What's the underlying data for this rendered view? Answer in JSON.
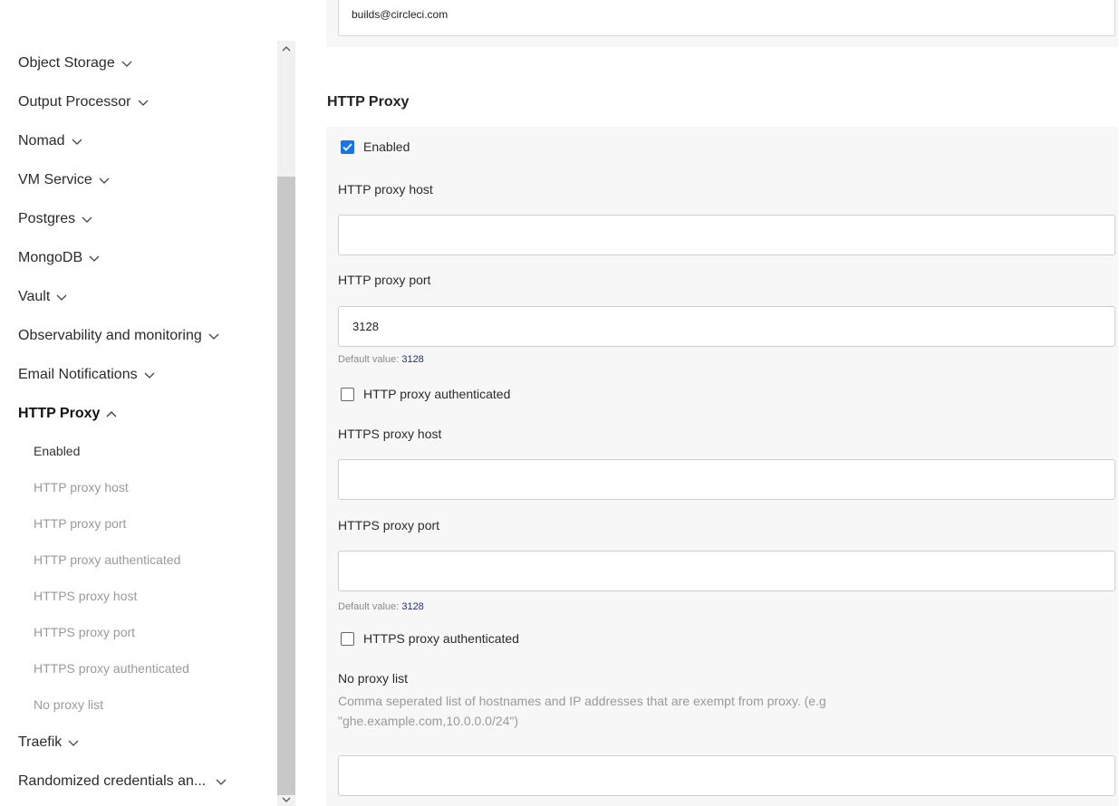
{
  "sidebar": {
    "items": [
      {
        "label": "Object Storage"
      },
      {
        "label": "Output Processor"
      },
      {
        "label": "Nomad"
      },
      {
        "label": "VM Service"
      },
      {
        "label": "Postgres"
      },
      {
        "label": "MongoDB"
      },
      {
        "label": "Vault"
      },
      {
        "label": "Observability and monitoring"
      },
      {
        "label": "Email Notifications"
      }
    ],
    "active_section": {
      "label": "HTTP Proxy",
      "sub_items": [
        {
          "label": "Enabled"
        },
        {
          "label": "HTTP proxy host"
        },
        {
          "label": "HTTP proxy port"
        },
        {
          "label": "HTTP proxy authenticated"
        },
        {
          "label": "HTTPS proxy host"
        },
        {
          "label": "HTTPS proxy port"
        },
        {
          "label": "HTTPS proxy authenticated"
        },
        {
          "label": "No proxy list"
        }
      ]
    },
    "after_items": [
      {
        "label": "Traefik"
      },
      {
        "label": "Randomized credentials an..."
      }
    ]
  },
  "main": {
    "top_field_value": "builds@circleci.com",
    "section_title": "HTTP Proxy",
    "enabled": {
      "label": "Enabled",
      "checked": true
    },
    "http_proxy_host": {
      "label": "HTTP proxy host",
      "value": ""
    },
    "http_proxy_port": {
      "label": "HTTP proxy port",
      "value": "3128",
      "default_prefix": "Default value:",
      "default_value": "3128"
    },
    "http_proxy_authenticated": {
      "label": "HTTP proxy authenticated",
      "checked": false
    },
    "https_proxy_host": {
      "label": "HTTPS proxy host",
      "value": ""
    },
    "https_proxy_port": {
      "label": "HTTPS proxy port",
      "value": "",
      "default_prefix": "Default value:",
      "default_value": "3128"
    },
    "https_proxy_authenticated": {
      "label": "HTTPS proxy authenticated",
      "checked": false
    },
    "no_proxy_list": {
      "label": "No proxy list",
      "description": "Comma seperated list of hostnames and IP addresses that are exempt from proxy. (e.g \"ghe.example.com,10.0.0.0/24\")",
      "value": ""
    }
  },
  "colors": {
    "accent": "#1a73e8",
    "panel_bg": "#f7f7f7",
    "scroll_thumb": "#c8c8c8"
  }
}
